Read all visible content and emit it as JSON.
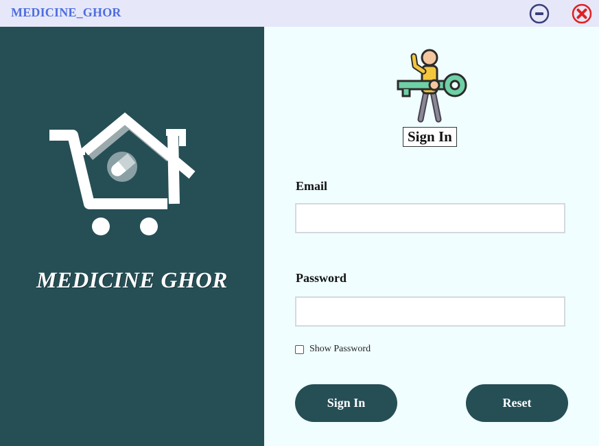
{
  "window": {
    "title": "MEDICINE_GHOR",
    "minimize_icon": "minus-circle-icon",
    "close_icon": "close-circle-icon",
    "close_color": "#e02020"
  },
  "left_panel": {
    "background": "#264e55",
    "logo_icon": "cart-house-pill-logo",
    "brand_name": "MEDICINE GHOR"
  },
  "form": {
    "hero_icon": "person-with-key-icon",
    "heading": "Sign In",
    "email_label": "Email",
    "email_value": "",
    "password_label": "Password",
    "password_value": "",
    "show_password_label": "Show Password",
    "show_password_checked": false,
    "signin_button": "Sign In",
    "reset_button": "Reset",
    "button_color": "#264e55"
  }
}
